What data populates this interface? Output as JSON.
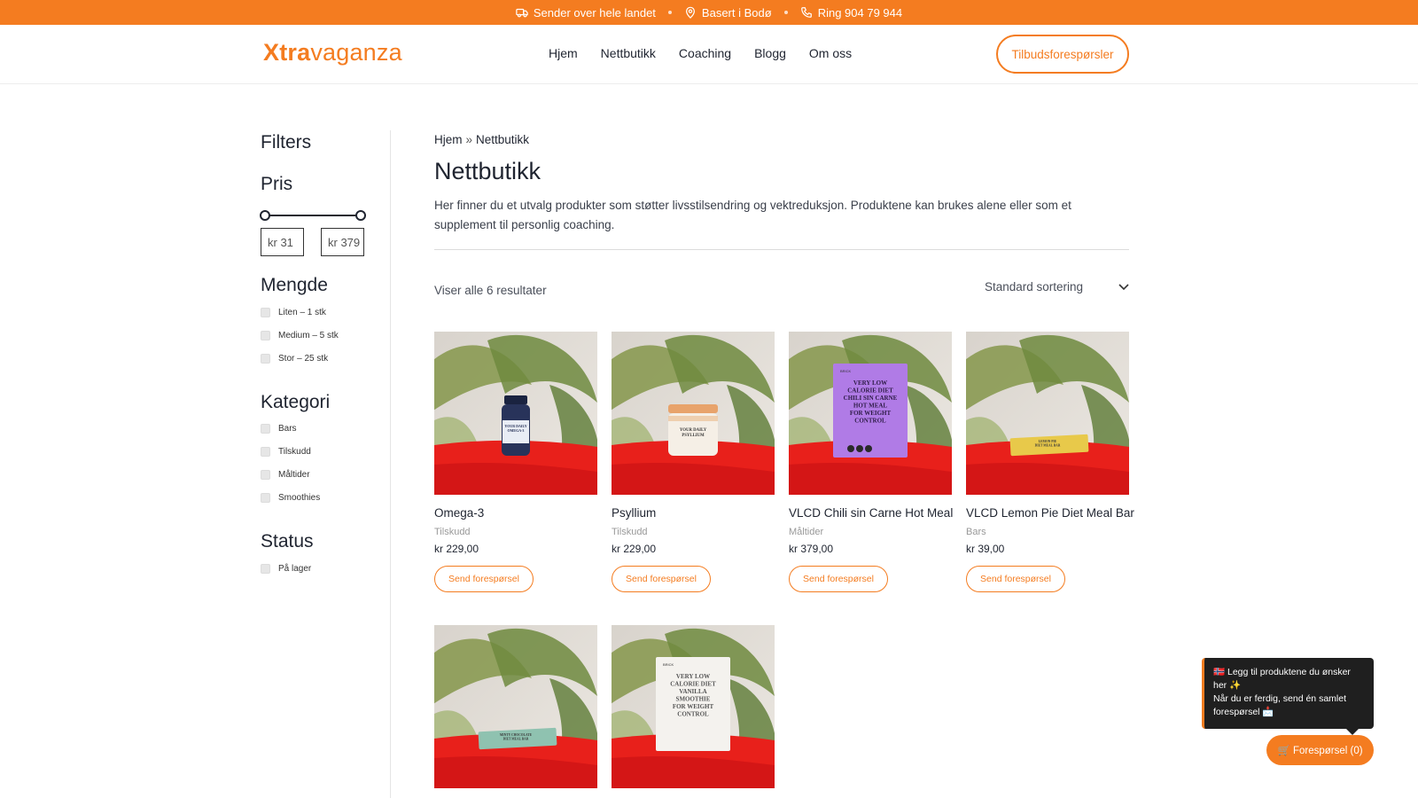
{
  "topbar": {
    "items": [
      {
        "icon": "truck-icon",
        "text": "Sender over hele landet"
      },
      {
        "icon": "location-pin-icon",
        "text": "Basert i Bodø"
      },
      {
        "icon": "phone-icon",
        "text": "Ring 904 79 944"
      }
    ]
  },
  "header": {
    "logo_bold": "Xtra",
    "logo_light": "vaganza",
    "nav": [
      "Hjem",
      "Nettbutikk",
      "Coaching",
      "Blogg",
      "Om oss"
    ],
    "cta_label": "Tilbudsforespørsler"
  },
  "sidebar": {
    "title": "Filters",
    "price": {
      "heading": "Pris",
      "min": "kr 31",
      "max": "kr 379",
      "range_fraction": [
        0.0,
        1.0
      ]
    },
    "groups": [
      {
        "heading": "Mengde",
        "options": [
          "Liten – 1 stk",
          "Medium – 5 stk",
          "Stor – 25 stk"
        ]
      },
      {
        "heading": "Kategori",
        "options": [
          "Bars",
          "Tilskudd",
          "Måltider",
          "Smoothies"
        ]
      },
      {
        "heading": "Status",
        "options": [
          "På lager"
        ]
      }
    ]
  },
  "main": {
    "breadcrumb": {
      "home": "Hjem",
      "sep": "»",
      "current": "Nettbutikk"
    },
    "title": "Nettbutikk",
    "description": "Her finner du et utvalg produkter som støtter livsstilsendring og vektreduksjon. Produktene kan brukes alene eller som et supplement til personlig coaching.",
    "results": "Viser alle 6 resultater",
    "sort_label": "Standard sortering",
    "products": [
      {
        "name": "Omega-3",
        "category": "Tilskudd",
        "price": "kr 229,00",
        "button": "Send forespørsel",
        "label_lines": [
          "YOUR DAILY",
          "OMEGA-3"
        ]
      },
      {
        "name": "Psyllium",
        "category": "Tilskudd",
        "price": "kr 229,00",
        "button": "Send forespørsel",
        "label_lines": [
          "YOUR DAILY",
          "PSYLLIUM"
        ]
      },
      {
        "name": "VLCD Chili sin Carne Hot Meal",
        "category": "Måltider",
        "price": "kr 379,00",
        "button": "Send forespørsel",
        "label_lines": [
          "VERY LOW",
          "CALORIE DIET",
          "CHILI SIN CARNE",
          "HOT MEAL",
          "FOR WEIGHT",
          "CONTROL"
        ]
      },
      {
        "name": "VLCD Lemon Pie Diet Meal Bar",
        "category": "Bars",
        "price": "kr 39,00",
        "button": "Send forespørsel",
        "label_lines": [
          "LEMON PIE",
          "DIET MEAL BAR"
        ]
      },
      {
        "name": "",
        "category": "",
        "price": "",
        "button": "",
        "label_lines": [
          "MINTY CHOCOLATE",
          "DIET MEAL BAR"
        ]
      },
      {
        "name": "",
        "category": "",
        "price": "",
        "button": "",
        "label_lines": [
          "VERY LOW",
          "CALORIE DIET",
          "VANILLA",
          "SMOOTHIE",
          "FOR WEIGHT",
          "CONTROL"
        ]
      }
    ]
  },
  "tooltip": {
    "line1": "🇳🇴 Legg til produktene du ønsker her ✨",
    "line2": "Når du er ferdig, send én samlet forespørsel 📩"
  },
  "fab": {
    "label": "🛒 Forespørsel (0)"
  },
  "colors": {
    "accent": "#f47c20",
    "text": "#1f2430"
  }
}
